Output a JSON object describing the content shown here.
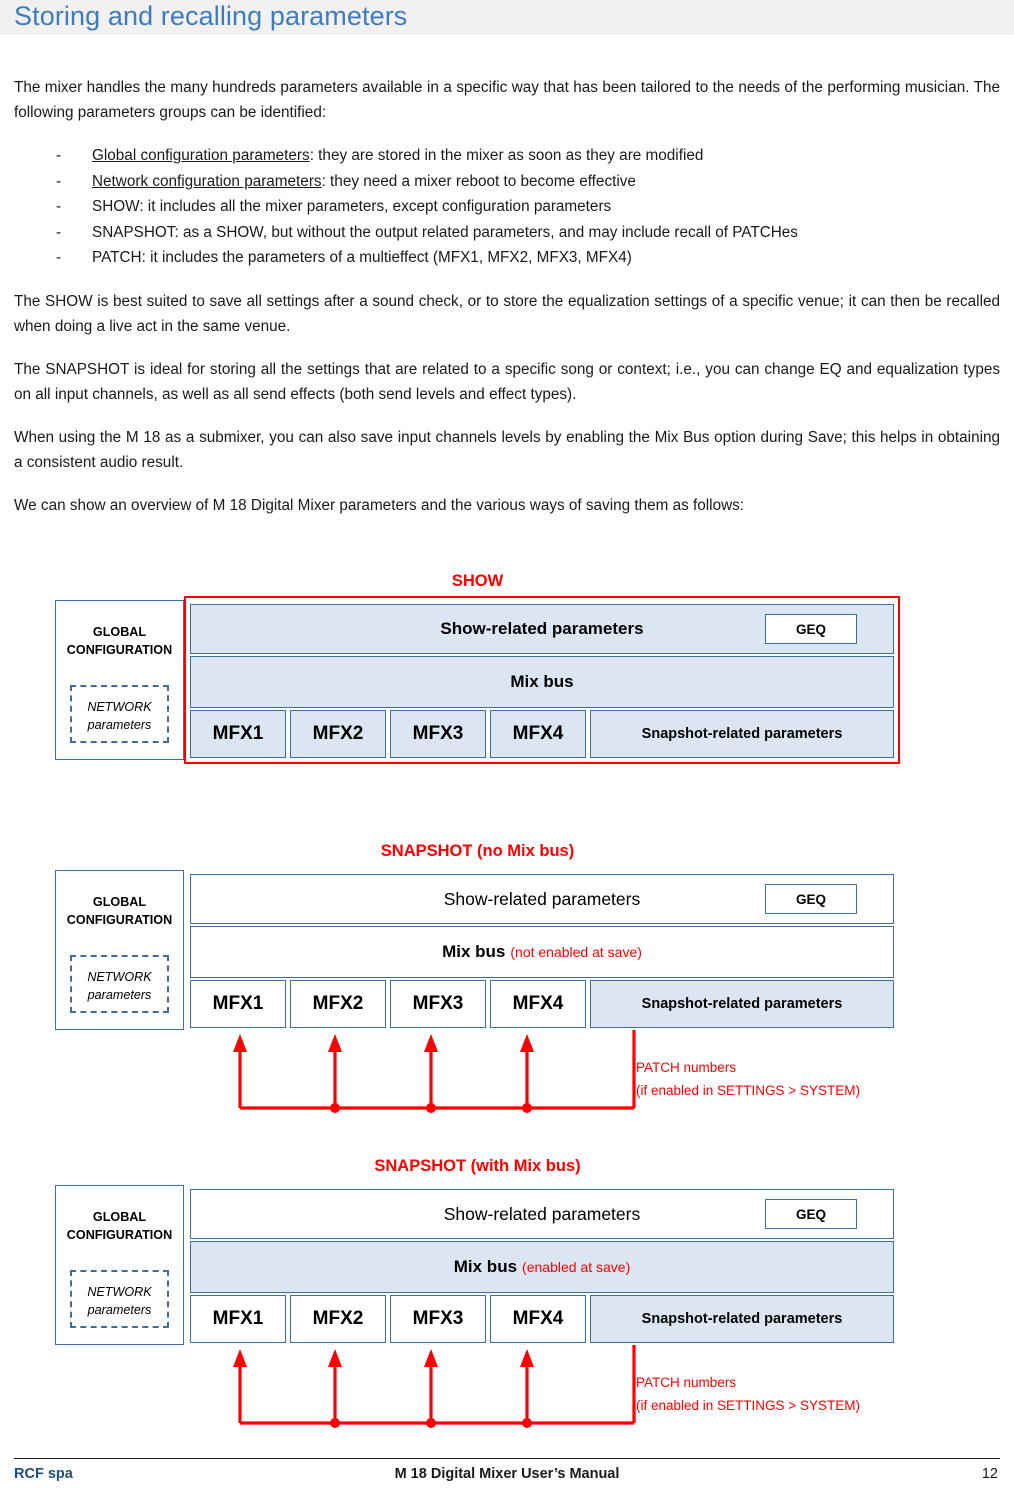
{
  "header": {
    "title": "Storing and recalling parameters"
  },
  "intro": "The mixer handles the many hundreds parameters available in a specific way that has been tailored to the needs of the performing musician.   The following parameters groups can be identified:",
  "bullets": [
    {
      "dash": "-",
      "term": "Global configuration parameters",
      "underlined": true,
      "rest": ": they are stored in the mixer as soon as they are modified"
    },
    {
      "dash": "-",
      "term": "Network configuration parameters",
      "underlined": true,
      "rest": ": they need a mixer reboot to become effective"
    },
    {
      "dash": "-",
      "term": "SHOW",
      "underlined": false,
      "rest": ": it includes all the mixer parameters, except configuration parameters"
    },
    {
      "dash": "-",
      "term": "SNAPSHOT",
      "underlined": false,
      "rest": ": as a SHOW, but without the output related parameters, and may include recall of PATCHes"
    },
    {
      "dash": "-",
      "term": "PATCH",
      "underlined": false,
      "rest": ": it includes the parameters  of a multieffect (MFX1, MFX2, MFX3, MFX4)"
    }
  ],
  "paragraphs": [
    "The SHOW is best suited to save all settings after a sound check, or to store the equalization settings of a specific venue; it can then be recalled when doing a live act in the same venue.",
    "The SNAPSHOT is ideal for storing all the settings that are related to a specific song or context; i.e., you can change EQ and equalization types on all input channels, as well as all send effects (both send levels and effect types).",
    "When using the M 18 as a submixer, you can also save input channels levels by enabling the Mix Bus option during Save; this helps in obtaining a consistent audio result.",
    "We can show an overview of M 18 Digital Mixer parameters and the various ways of saving them as follows:"
  ],
  "diagrams": [
    {
      "title": "SHOW",
      "global_config": "GLOBAL\nCONFIGURATION",
      "global_config_line1": "GLOBAL",
      "global_config_line2": "CONFIGURATION",
      "network_line1": "NETWORK",
      "network_line2": "parameters",
      "show_row_label": "Show-related parameters",
      "geq": "GEQ",
      "mix_label": "Mix bus",
      "mix_note": "",
      "mfx": [
        "MFX1",
        "MFX2",
        "MFX3",
        "MFX4"
      ],
      "snapshot_label": "Snapshot-related parameters",
      "patch_label_line1": "",
      "patch_label_line2": ""
    },
    {
      "title": "SNAPSHOT (no Mix bus)",
      "global_config_line1": "GLOBAL",
      "global_config_line2": "CONFIGURATION",
      "network_line1": "NETWORK",
      "network_line2": "parameters",
      "show_row_label": "Show-related parameters",
      "geq": "GEQ",
      "mix_label": "Mix bus",
      "mix_note": "(not enabled at save)",
      "mfx": [
        "MFX1",
        "MFX2",
        "MFX3",
        "MFX4"
      ],
      "snapshot_label": "Snapshot-related parameters",
      "patch_label_line1": "PATCH numbers",
      "patch_label_line2": "(if enabled in SETTINGS > SYSTEM)"
    },
    {
      "title": "SNAPSHOT (with Mix bus)",
      "global_config_line1": "GLOBAL",
      "global_config_line2": "CONFIGURATION",
      "network_line1": "NETWORK",
      "network_line2": "parameters",
      "show_row_label": "Show-related parameters",
      "geq": "GEQ",
      "mix_label": "Mix bus",
      "mix_note": "(enabled at save)",
      "mfx": [
        "MFX1",
        "MFX2",
        "MFX3",
        "MFX4"
      ],
      "snapshot_label": "Snapshot-related parameters",
      "patch_label_line1": "PATCH numbers",
      "patch_label_line2": "(if enabled in SETTINGS > SYSTEM)"
    }
  ],
  "footer": {
    "left": "RCF spa",
    "center": "M 18 Digital Mixer User’s Manual",
    "page": "12"
  },
  "colors": {
    "heading_blue": "#3f7cbf",
    "header_band": "#f1f1f1",
    "box_border_blue": "#3c6e9f",
    "box_fill_blue": "#dce6f2",
    "accent_red": "#ff0000",
    "footer_blue": "#1f4e79"
  }
}
